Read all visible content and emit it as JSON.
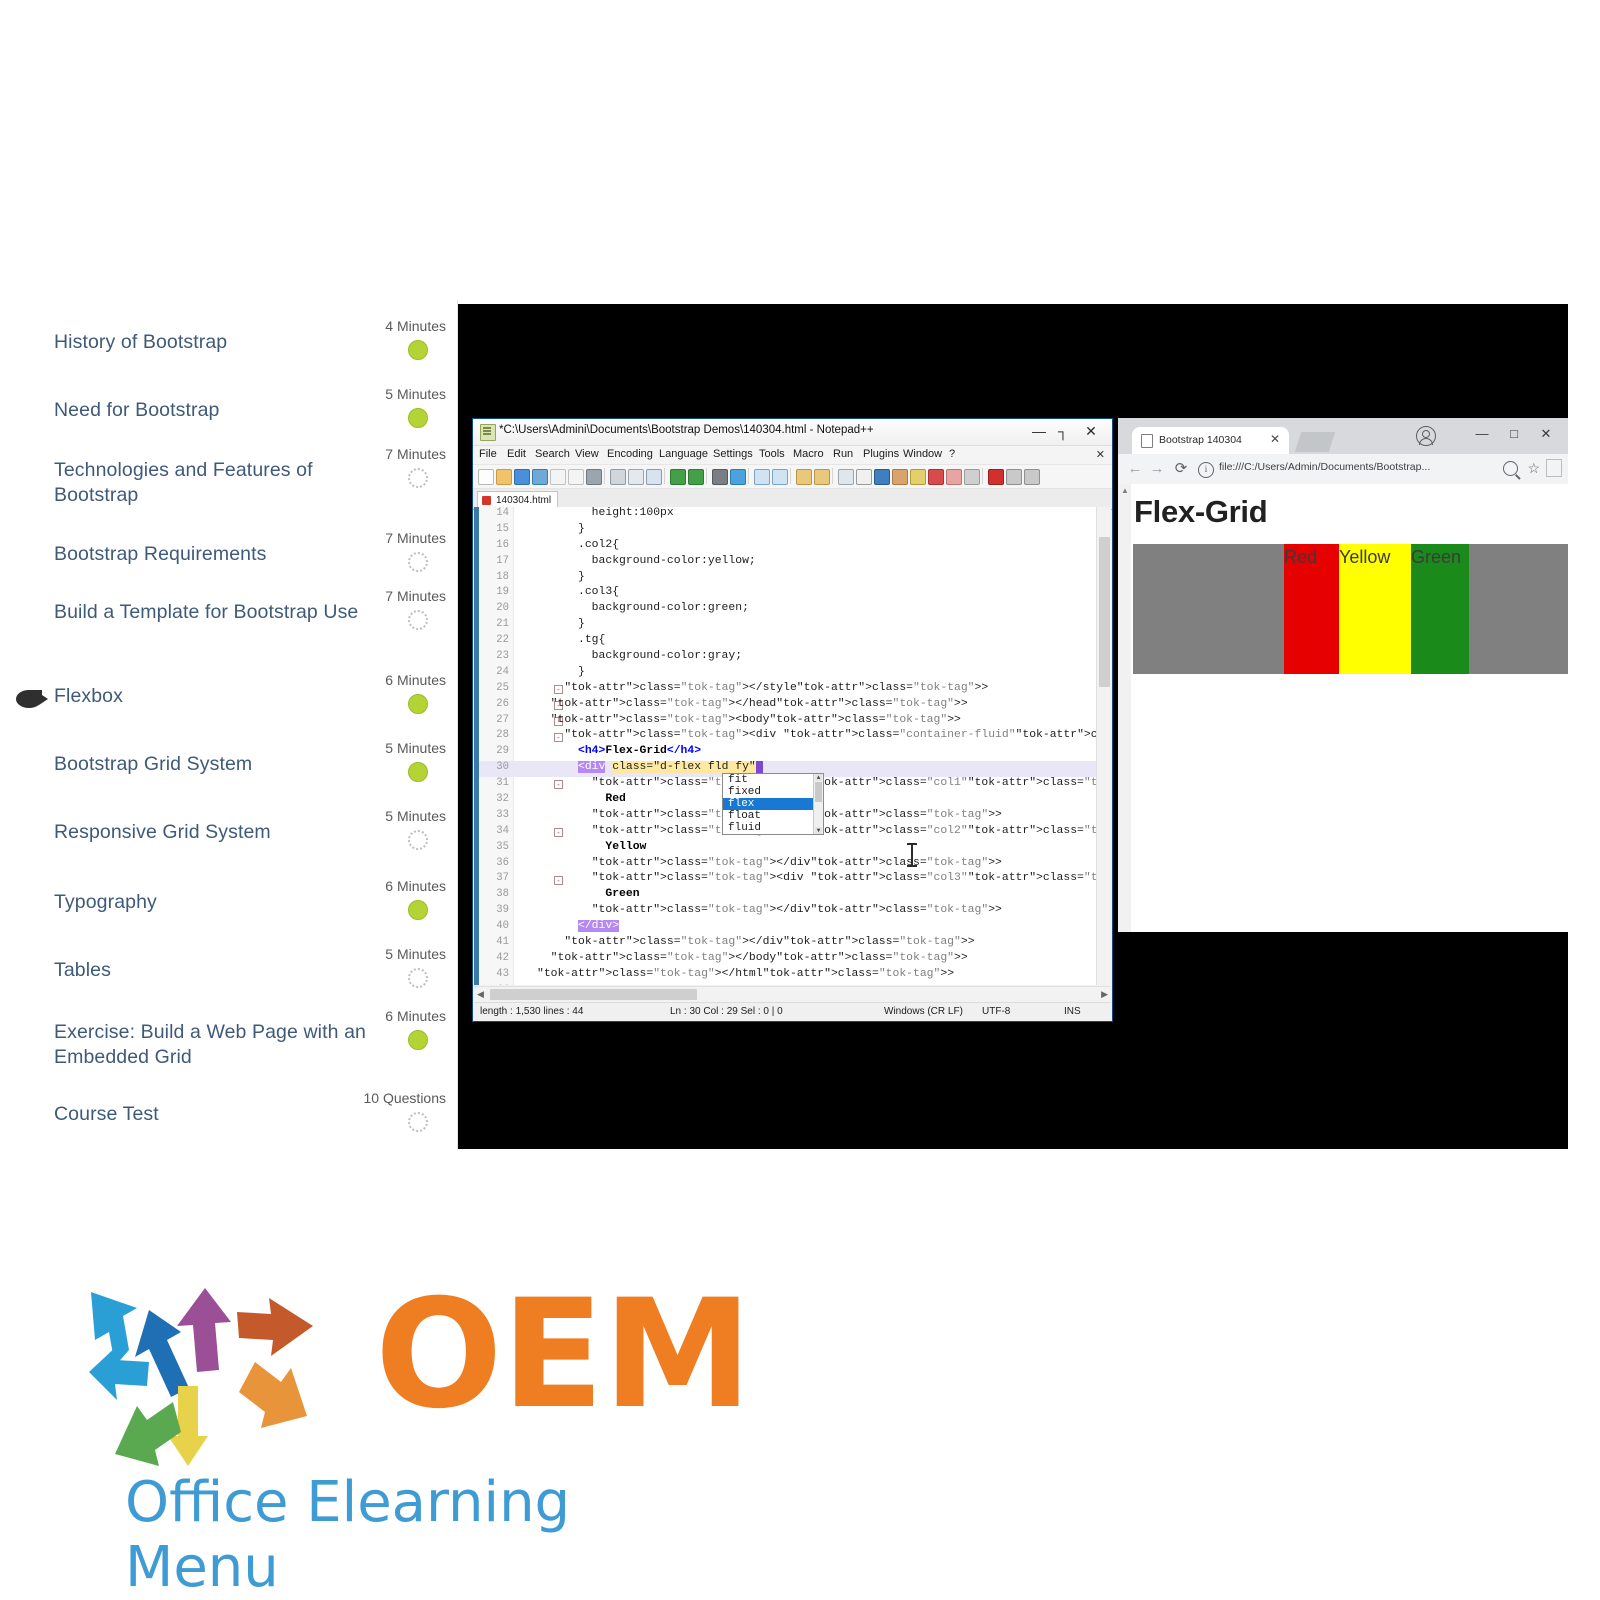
{
  "outline": {
    "lessons": [
      {
        "title": "History of Bootstrap",
        "meta": "4 Minutes",
        "status": "done",
        "current": false
      },
      {
        "title": "Need for Bootstrap",
        "meta": "5 Minutes",
        "status": "done",
        "current": false
      },
      {
        "title": "Technologies and Features of Bootstrap",
        "meta": "7 Minutes",
        "status": "todo",
        "current": false
      },
      {
        "title": "Bootstrap Requirements",
        "meta": "7 Minutes",
        "status": "todo",
        "current": false
      },
      {
        "title": "Build a Template for Bootstrap Use",
        "meta": "7 Minutes",
        "status": "todo",
        "current": false
      },
      {
        "title": "Flexbox",
        "meta": "6 Minutes",
        "status": "done",
        "current": true
      },
      {
        "title": "Bootstrap Grid System",
        "meta": "5 Minutes",
        "status": "done",
        "current": false
      },
      {
        "title": "Responsive Grid System",
        "meta": "5 Minutes",
        "status": "todo",
        "current": false
      },
      {
        "title": "Typography",
        "meta": "6 Minutes",
        "status": "done",
        "current": false
      },
      {
        "title": "Tables",
        "meta": "5 Minutes",
        "status": "todo",
        "current": false
      },
      {
        "title": "Exercise: Build a Web Page with an Embedded Grid",
        "meta": "6 Minutes",
        "status": "done",
        "current": false
      },
      {
        "title": "Course Test",
        "meta": "10 Questions",
        "status": "todo",
        "current": false
      }
    ]
  },
  "notepad": {
    "window_title": "*C:\\Users\\Admini\\Documents\\Bootstrap Demos\\140304.html - Notepad++",
    "minimize_label": "—",
    "maximize_label": "┐",
    "close_label": "✕",
    "menu": [
      "File",
      "Edit",
      "Search",
      "View",
      "Encoding",
      "Language",
      "Settings",
      "Tools",
      "Macro",
      "Run",
      "Plugins",
      "Window",
      "?"
    ],
    "menu_close_label": "✕",
    "document_tab": "140304.html",
    "code_lines": [
      {
        "n": "14",
        "text": "        height:100px"
      },
      {
        "n": "15",
        "text": "      }"
      },
      {
        "n": "16",
        "text": "      .col2{"
      },
      {
        "n": "17",
        "text": "        background-color:yellow;"
      },
      {
        "n": "18",
        "text": "      }"
      },
      {
        "n": "19",
        "text": "      .col3{"
      },
      {
        "n": "20",
        "text": "        background-color:green;"
      },
      {
        "n": "21",
        "text": "      }"
      },
      {
        "n": "22",
        "text": "      .tg{"
      },
      {
        "n": "23",
        "text": "        background-color:gray;"
      },
      {
        "n": "24",
        "text": "      }"
      },
      {
        "n": "25",
        "text": "    </style>"
      },
      {
        "n": "26",
        "text": "  </head>"
      },
      {
        "n": "27",
        "text": "  <body>"
      },
      {
        "n": "28",
        "text": "    <div class=\"container-fluid\">"
      },
      {
        "n": "29",
        "text": "      <h4>Flex-Grid</h4>"
      },
      {
        "n": "30",
        "text": "      <div class=\"d-flex fld fy\">"
      },
      {
        "n": "31",
        "text": "        <div class=\"col1\">"
      },
      {
        "n": "32",
        "text": "          Red"
      },
      {
        "n": "33",
        "text": "        </div>"
      },
      {
        "n": "34",
        "text": "        <div class=\"col2\">"
      },
      {
        "n": "35",
        "text": "          Yellow"
      },
      {
        "n": "36",
        "text": "        </div>"
      },
      {
        "n": "37",
        "text": "        <div class=\"col3\">"
      },
      {
        "n": "38",
        "text": "          Green"
      },
      {
        "n": "39",
        "text": "        </div>"
      },
      {
        "n": "40",
        "text": "      </div>"
      },
      {
        "n": "41",
        "text": "    </div>"
      },
      {
        "n": "42",
        "text": "  </body>"
      },
      {
        "n": "43",
        "text": "</html>"
      },
      {
        "n": "44",
        "text": ""
      }
    ],
    "autocomplete": {
      "items": [
        "fit",
        "fixed",
        "flex",
        "float",
        "fluid"
      ],
      "selected": "flex"
    },
    "status": {
      "length_lines": "length : 1,530    lines : 44",
      "caret": "Ln : 30    Col : 29    Sel : 0 | 0",
      "eol": "Windows (CR LF)",
      "encoding": "UTF-8",
      "insert_mode": "INS"
    }
  },
  "browser": {
    "tab_title": "Bootstrap 140304",
    "tab_close_label": "✕",
    "url": "file:///C:/Users/Admin/Documents/Bootstrap...",
    "back_label": "←",
    "forward_label": "→",
    "reload_label": "⟳",
    "info_label": "i",
    "star_label": "☆",
    "minimize_label": "—",
    "maximize_label": "□",
    "close_label": "✕",
    "scroll_up_label": "▲",
    "page": {
      "heading": "Flex-Grid",
      "container_bg": "#808080",
      "columns": [
        {
          "label": "Red",
          "color": "#e60000"
        },
        {
          "label": "Yellow",
          "color": "#ffff00"
        },
        {
          "label": "Green",
          "color": "#1a8a1a"
        }
      ]
    }
  },
  "logo": {
    "word": "OEM",
    "tagline": "Office Elearning Menu",
    "word_color": "#ef7d22",
    "tagline_color": "#3e9bd4",
    "arrow_colors": [
      "#1f6fb5",
      "#9b4f96",
      "#c45a2c",
      "#e8943a",
      "#2a9fd6",
      "#e8d24a",
      "#5aa84f",
      "#d9742b"
    ]
  }
}
